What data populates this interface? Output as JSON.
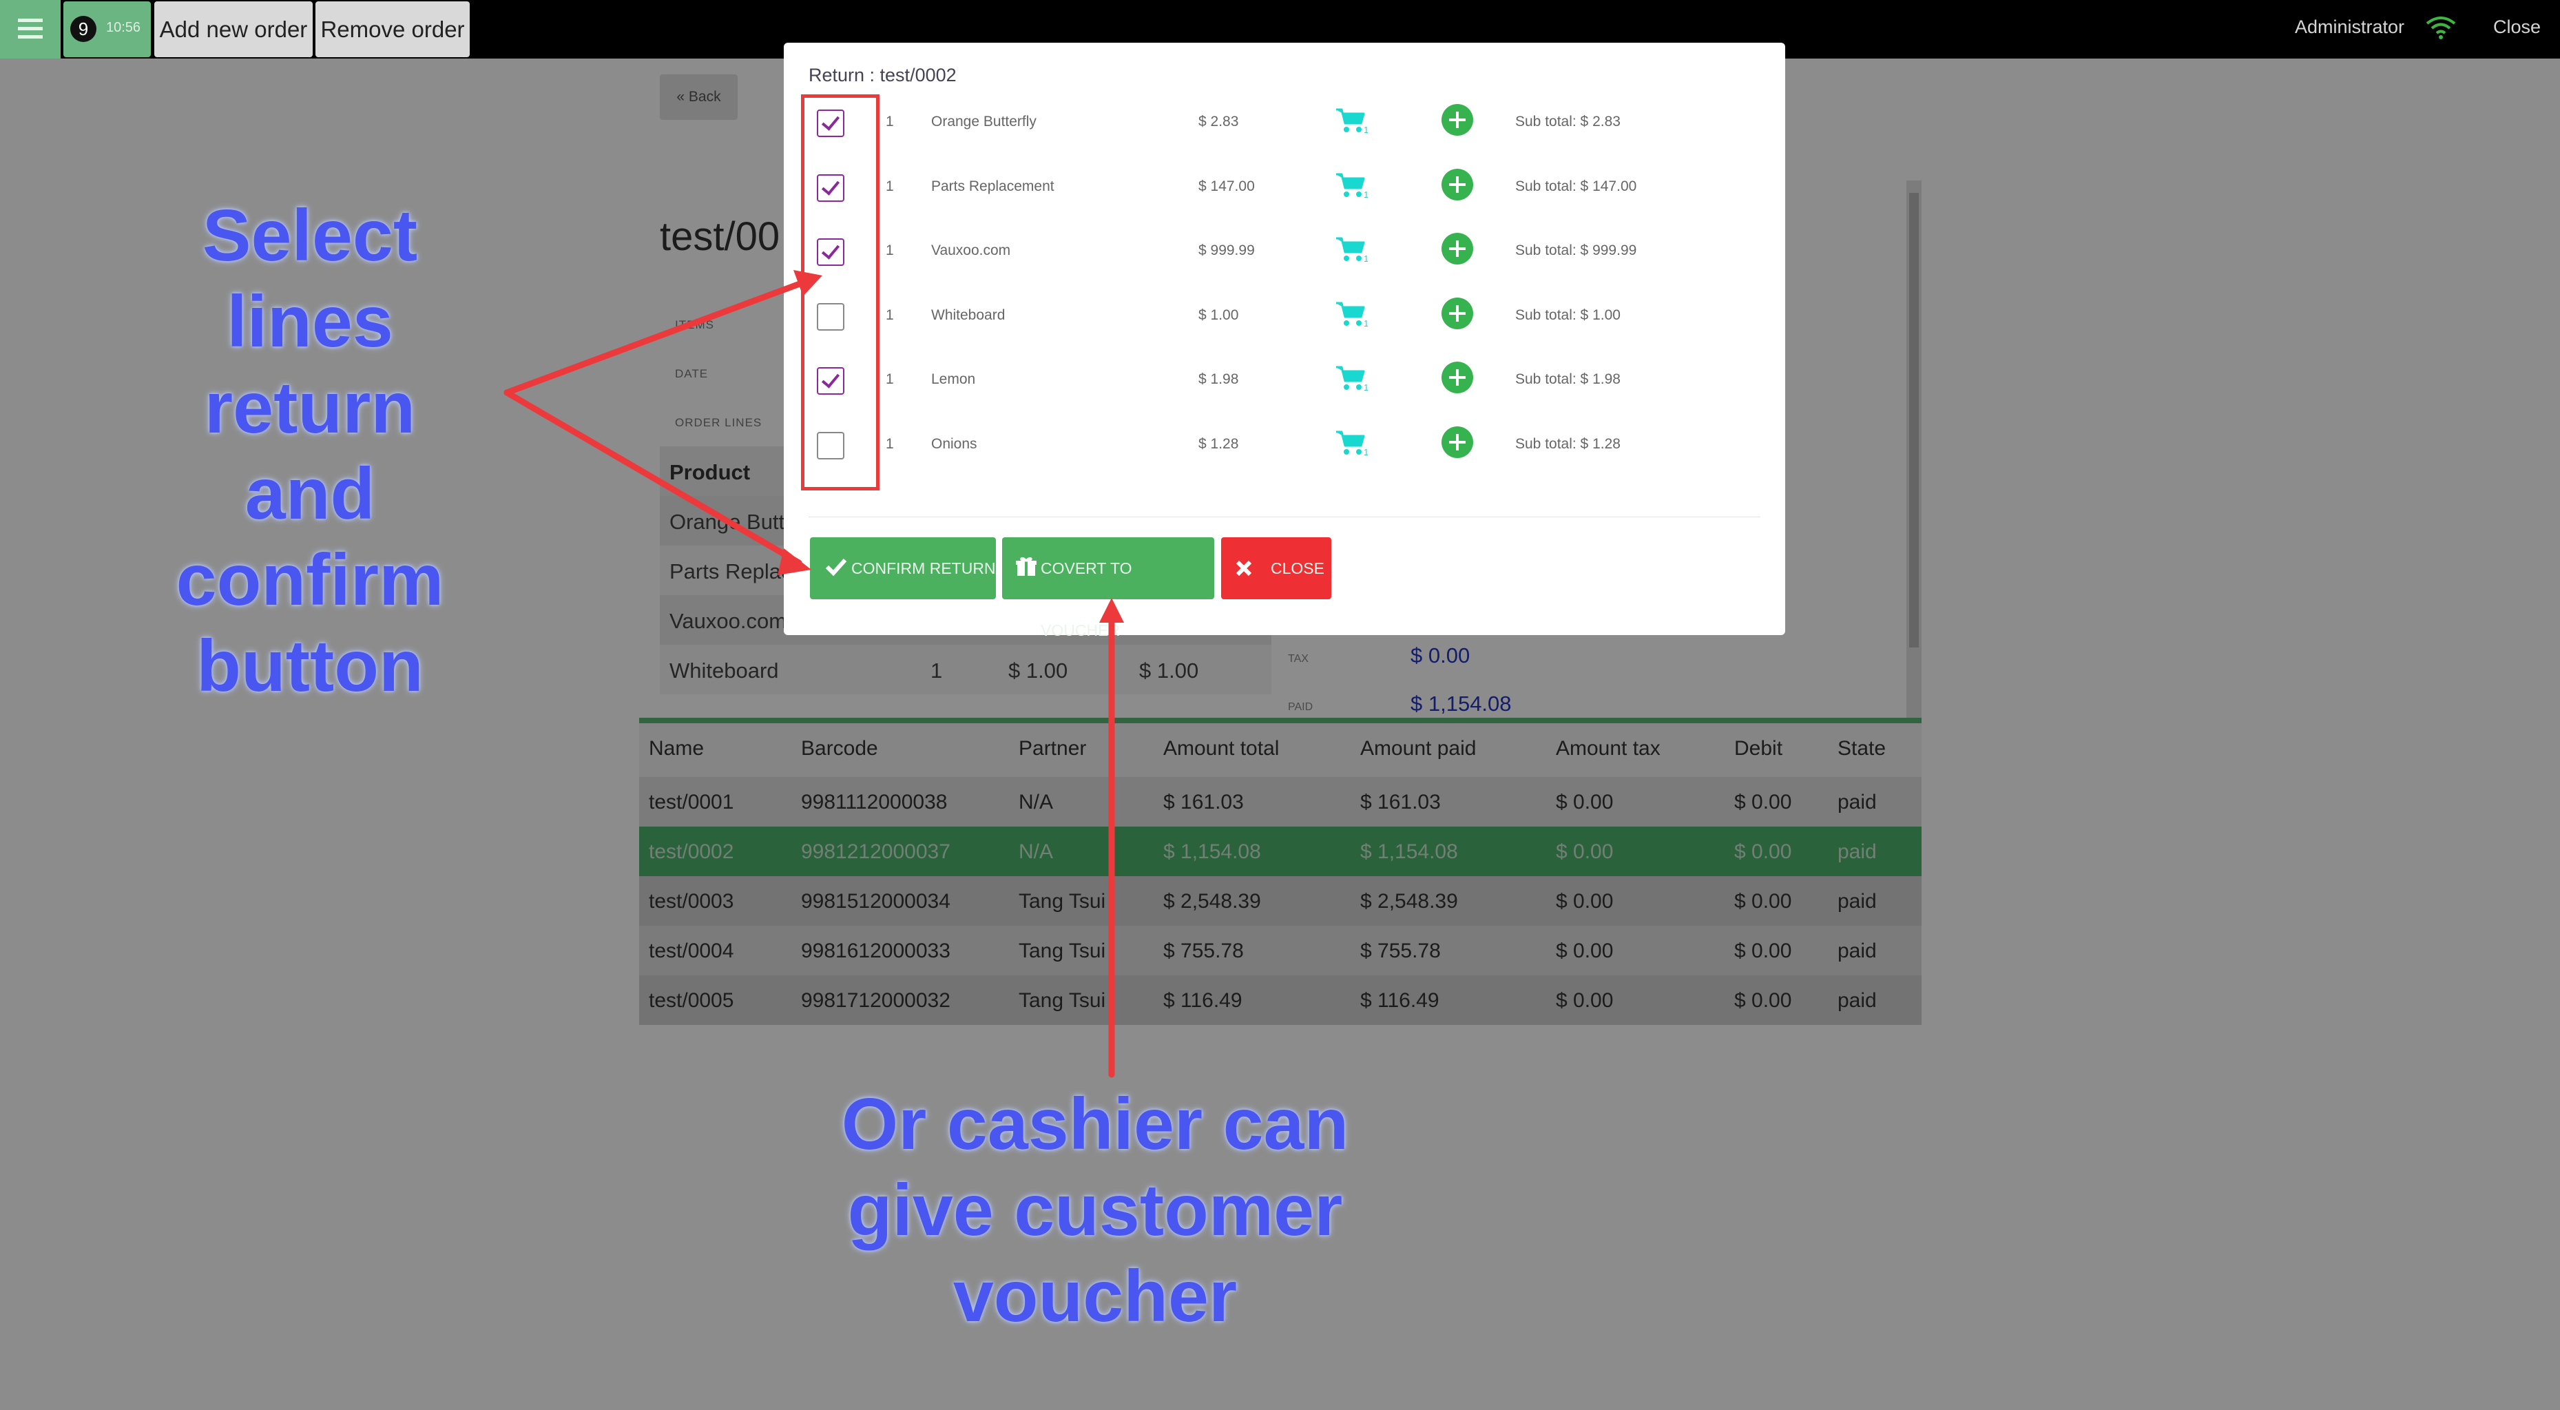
{
  "topbar": {
    "order_number": "9",
    "order_time": "10:56",
    "add_order": "Add new order",
    "remove_order": "Remove order",
    "user": "Administrator",
    "close": "Close"
  },
  "page": {
    "back": "« Back",
    "ticket_title": "test/00",
    "labels": {
      "items": "ITEMS",
      "date": "DATE",
      "order_lines": "ORDER LINES",
      "tax": "TAX",
      "paid": "PAID"
    },
    "lines_header": "Product",
    "lines": [
      {
        "product": "Orange Butt",
        "qty": "",
        "price": "",
        "subtotal": ""
      },
      {
        "product": "Parts Replac",
        "qty": "",
        "price": "",
        "subtotal": ""
      },
      {
        "product": "Vauxoo.com",
        "qty": "",
        "price": "",
        "subtotal": ""
      },
      {
        "product": "Whiteboard",
        "qty": "1",
        "price": "$ 1.00",
        "subtotal": "$ 1.00"
      }
    ],
    "tax_value": "$ 0.00",
    "paid_value": "$ 1,154.08"
  },
  "orders": {
    "columns": [
      "Name",
      "Barcode",
      "Partner",
      "Amount total",
      "Amount paid",
      "Amount tax",
      "Debit",
      "State"
    ],
    "rows": [
      [
        "test/0001",
        "9981112000038",
        "N/A",
        "$ 161.03",
        "$ 161.03",
        "$ 0.00",
        "$ 0.00",
        "paid"
      ],
      [
        "test/0002",
        "9981212000037",
        "N/A",
        "$ 1,154.08",
        "$ 1,154.08",
        "$ 0.00",
        "$ 0.00",
        "paid"
      ],
      [
        "test/0003",
        "9981512000034",
        "Tang Tsui",
        "$ 2,548.39",
        "$ 2,548.39",
        "$ 0.00",
        "$ 0.00",
        "paid"
      ],
      [
        "test/0004",
        "9981612000033",
        "Tang Tsui",
        "$ 755.78",
        "$ 755.78",
        "$ 0.00",
        "$ 0.00",
        "paid"
      ],
      [
        "test/0005",
        "9981712000032",
        "Tang Tsui",
        "$ 116.49",
        "$ 116.49",
        "$ 0.00",
        "$ 0.00",
        "paid"
      ]
    ],
    "selected_index": 1
  },
  "modal": {
    "title": "Return : test/0002",
    "lines": [
      {
        "checked": true,
        "qty": "1",
        "name": "Orange Butterfly",
        "price": "$ 2.83",
        "cart_count": "1",
        "subtotal": "Sub total: $ 2.83"
      },
      {
        "checked": true,
        "qty": "1",
        "name": "Parts Replacement",
        "price": "$ 147.00",
        "cart_count": "1",
        "subtotal": "Sub total: $ 147.00"
      },
      {
        "checked": true,
        "qty": "1",
        "name": "Vauxoo.com",
        "price": "$ 999.99",
        "cart_count": "1",
        "subtotal": "Sub total: $ 999.99"
      },
      {
        "checked": false,
        "qty": "1",
        "name": "Whiteboard",
        "price": "$ 1.00",
        "cart_count": "1",
        "subtotal": "Sub total: $ 1.00"
      },
      {
        "checked": true,
        "qty": "1",
        "name": "Lemon",
        "price": "$ 1.98",
        "cart_count": "1",
        "subtotal": "Sub total: $ 1.98"
      },
      {
        "checked": false,
        "qty": "1",
        "name": "Onions",
        "price": "$ 1.28",
        "cart_count": "1",
        "subtotal": "Sub total: $ 1.28"
      }
    ],
    "confirm": "CONFIRM RETURN",
    "voucher": "COVERT TO VOUCHER",
    "close": "CLOSE"
  },
  "annotations": {
    "left": [
      "Select",
      "lines",
      "return",
      "and",
      "confirm",
      "button"
    ],
    "bottom": [
      "Or cashier can",
      "give customer",
      "voucher"
    ]
  },
  "colors": {
    "accent_green": "#4eb26d",
    "close_red": "#ee3034",
    "annotation_blue": "#4a56f0",
    "arrow_red": "#ec3a3c",
    "checkbox_purple": "#8a2a9a",
    "cart_cyan": "#18d8d0"
  }
}
